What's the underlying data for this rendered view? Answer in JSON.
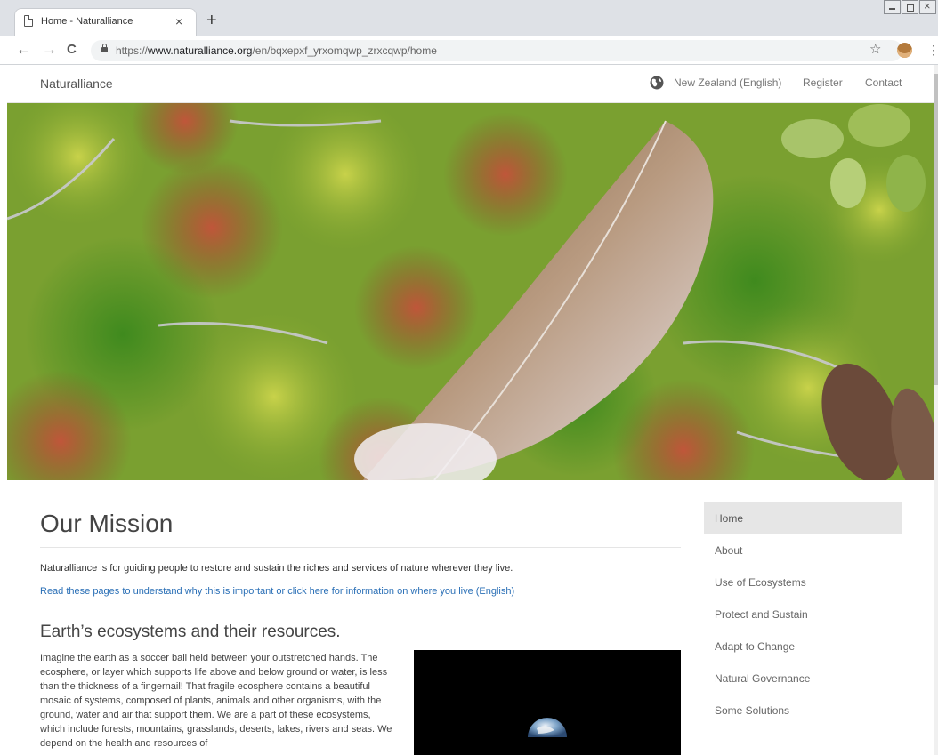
{
  "browser": {
    "tab_title": "Home - Naturalliance",
    "tab_close": "×",
    "new_tab": "+",
    "url_scheme": "https://",
    "url_host": "www.naturalliance.org",
    "url_path": "/en/bqxepxf_yrxomqwp_zrxcqwp/home",
    "back": "←",
    "forward": "→",
    "reload": "C",
    "star": "☆",
    "menu": "⋮"
  },
  "header": {
    "brand": "Naturalliance",
    "region": "New Zealand (English)",
    "register": "Register",
    "contact": "Contact"
  },
  "main": {
    "mission_title": "Our Mission",
    "intro": "Naturalliance is for guiding people to restore and sustain the riches and services of nature wherever they live.",
    "intro_link": "Read these pages to understand why this is important or click here for information on where you live (English)",
    "eco_title": "Earth’s ecosystems and their resources.",
    "eco_body": "Imagine the earth as a soccer ball held between your outstretched hands. The ecosphere, or layer which supports life above and below ground or water, is less than the thickness of a fingernail! That fragile ecosphere contains a beautiful mosaic of systems, composed of plants, animals and other organisms, with the ground, water and air that support them. We are a part of these ecosystems, which include forests, mountains, grasslands, deserts, lakes, rivers and seas. We depend on the health and resources of"
  },
  "sidenav": {
    "items": [
      {
        "label": "Home",
        "active": true
      },
      {
        "label": "About"
      },
      {
        "label": "Use of Ecosystems"
      },
      {
        "label": "Protect and Sustain"
      },
      {
        "label": "Adapt to Change"
      },
      {
        "label": "Natural Governance"
      },
      {
        "label": "Some Solutions"
      }
    ]
  },
  "colors": {
    "link": "#2a6fb6",
    "active_nav_bg": "#e6e6e6",
    "heading": "#444444"
  },
  "icons": {
    "tab": "page-icon",
    "secure": "lock-icon",
    "region": "globe-icon",
    "bookmark": "star-icon",
    "profile": "avatar-icon"
  }
}
